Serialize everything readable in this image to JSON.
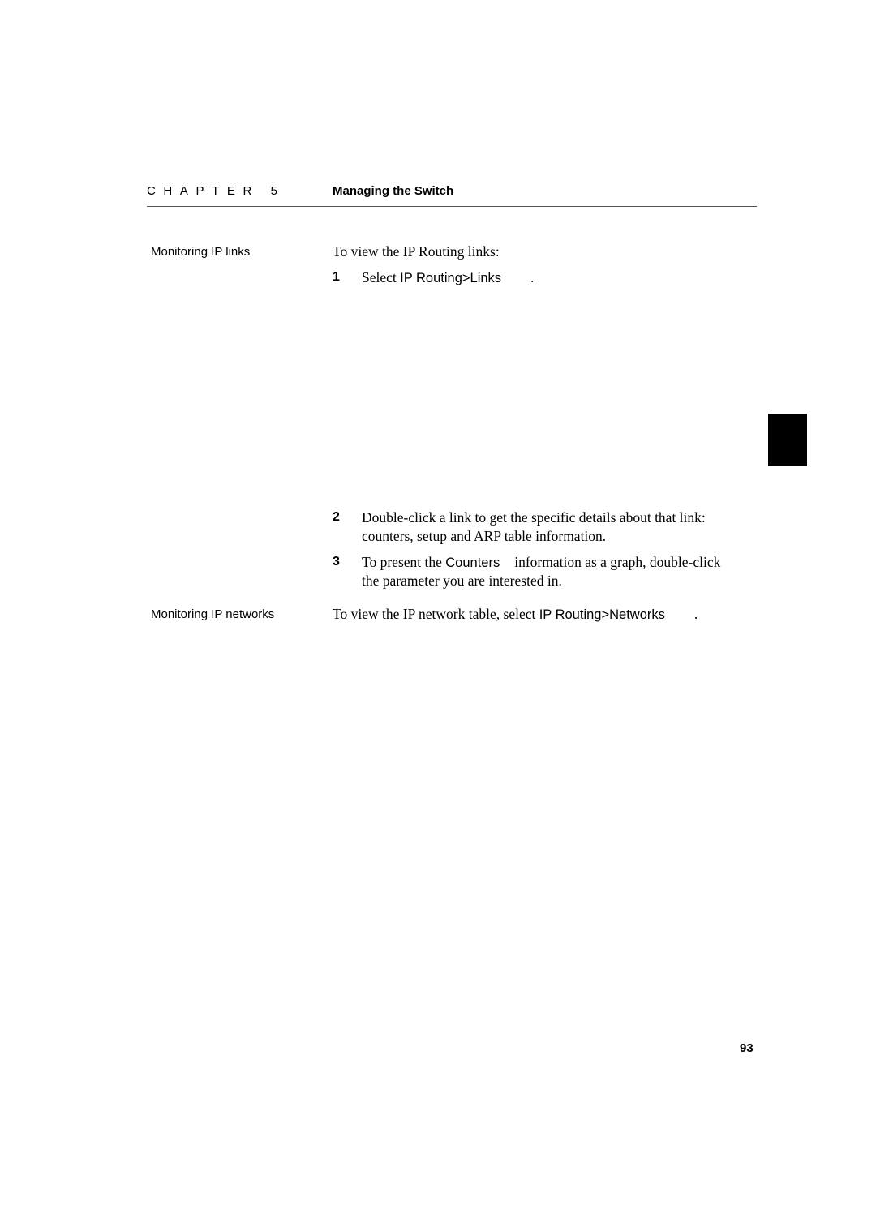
{
  "header": {
    "chapter_label": "CHAPTER 5",
    "chapter_title": "Managing the Switch"
  },
  "sections": [
    {
      "sidehead": "Monitoring IP links",
      "intro": "To view the IP Routing links:",
      "steps": [
        {
          "number": "1",
          "text_before": "Select ",
          "ui_term": "IP Routing>Links",
          "text_after": "."
        },
        {
          "number": "2",
          "line1": "Double-click a link to get the specific details about that link:",
          "line2": "counters, setup and ARP table information."
        },
        {
          "number": "3",
          "text_before": "To present the ",
          "ui_term": "Counters",
          "text_after": "information as a graph, double-click",
          "line2": "the parameter you are interested in."
        }
      ]
    },
    {
      "sidehead": "Monitoring IP networks",
      "text_before": "To view the IP network table, select ",
      "ui_term": "IP Routing>Networks",
      "text_after": "."
    }
  ],
  "footer": {
    "page_number": "93"
  }
}
